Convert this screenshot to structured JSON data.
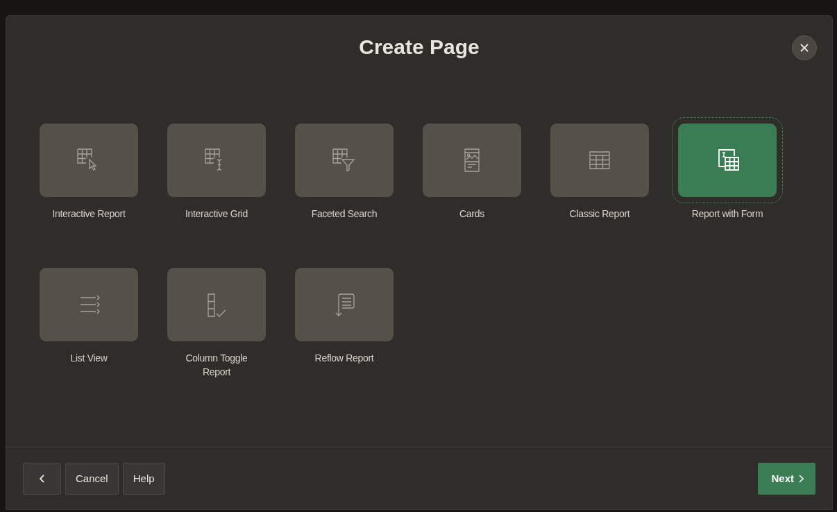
{
  "dialog": {
    "title": "Create Page"
  },
  "page_types": [
    {
      "label": "Interactive Report",
      "kind": "interactive-report",
      "selected": false
    },
    {
      "label": "Interactive Grid",
      "kind": "interactive-grid",
      "selected": false
    },
    {
      "label": "Faceted Search",
      "kind": "faceted-search",
      "selected": false
    },
    {
      "label": "Cards",
      "kind": "cards",
      "selected": false
    },
    {
      "label": "Classic Report",
      "kind": "classic-report",
      "selected": false
    },
    {
      "label": "Report with Form",
      "kind": "report-form",
      "selected": true
    },
    {
      "label": "List View",
      "kind": "list-view",
      "selected": false
    },
    {
      "label": "Column Toggle Report",
      "kind": "column-toggle",
      "selected": false
    },
    {
      "label": "Reflow Report",
      "kind": "reflow",
      "selected": false
    }
  ],
  "footer": {
    "buttons": [
      {
        "label": "Cancel"
      },
      {
        "label": "Help"
      }
    ],
    "next": "Next"
  }
}
